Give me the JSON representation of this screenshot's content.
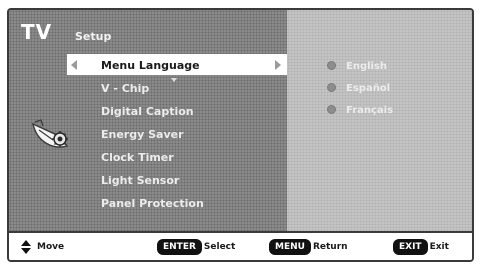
{
  "header": {
    "tv_label": "TV",
    "section_title": "Setup"
  },
  "menu": {
    "items": [
      {
        "label": "Menu Language",
        "selected": true
      },
      {
        "label": "V - Chip",
        "selected": false
      },
      {
        "label": "Digital Caption",
        "selected": false
      },
      {
        "label": "Energy Saver",
        "selected": false
      },
      {
        "label": "Clock Timer",
        "selected": false
      },
      {
        "label": "Light Sensor",
        "selected": false
      },
      {
        "label": "Panel Protection",
        "selected": false
      }
    ]
  },
  "options": {
    "items": [
      {
        "label": "English"
      },
      {
        "label": "Español"
      },
      {
        "label": "Français"
      }
    ]
  },
  "footer": {
    "move_label": "Move",
    "enter_key": "ENTER",
    "enter_label": "Select",
    "menu_key": "MENU",
    "menu_label": "Return",
    "exit_key": "EXIT",
    "exit_label": "Exit"
  },
  "icons": {
    "setup": "satellite-dish-icon",
    "move": "up-down-arrow-icon"
  },
  "colors": {
    "menu_background": "#8a8a8a",
    "option_panel_background": "#c4c4c4",
    "highlight": "#ffffff",
    "footer_background": "#ffffff",
    "key_badge": "#111111"
  }
}
